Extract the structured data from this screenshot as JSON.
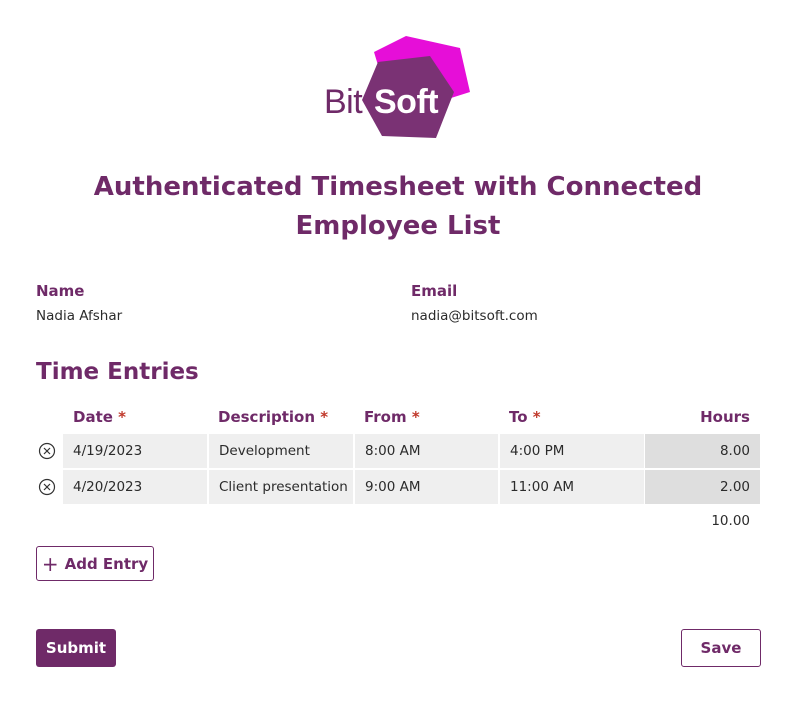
{
  "logo": {
    "part1": "Bit",
    "part2": "Soft"
  },
  "title": "Authenticated Timesheet with Connected Employee List",
  "fields": {
    "name_label": "Name",
    "name_value": "Nadia Afshar",
    "email_label": "Email",
    "email_value": "nadia@bitsoft.com"
  },
  "time_entries": {
    "heading": "Time Entries",
    "columns": {
      "date": "Date",
      "description": "Description",
      "from": "From",
      "to": "To",
      "hours": "Hours",
      "required_marker": "*"
    },
    "rows": [
      {
        "date": "4/19/2023",
        "description": "Development",
        "from": "8:00 AM",
        "to": "4:00 PM",
        "hours": "8.00"
      },
      {
        "date": "4/20/2023",
        "description": "Client presentation",
        "from": "9:00 AM",
        "to": "11:00 AM",
        "hours": "2.00"
      }
    ],
    "total_hours": "10.00",
    "add_entry_label": "Add Entry"
  },
  "actions": {
    "submit_label": "Submit",
    "save_label": "Save"
  },
  "colors": {
    "brand": "#6f2a68",
    "accent_magenta": "#e60ed8",
    "required": "#c0392b"
  }
}
